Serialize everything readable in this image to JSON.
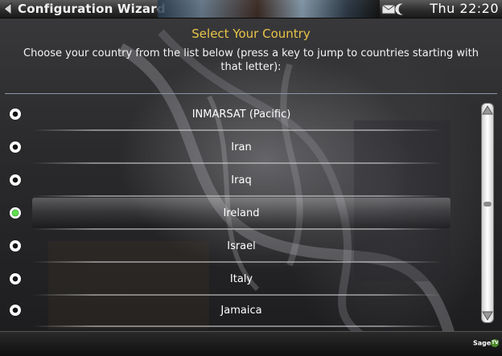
{
  "window": {
    "title": "Configuration Wizard",
    "clock": "Thu 22:20"
  },
  "header": {
    "heading": "Select Your Country",
    "instructions": "Choose your country from the list below (press a key to jump to countries starting with that letter):"
  },
  "countries": [
    {
      "label": "INMARSAT (Pacific)",
      "selected": false
    },
    {
      "label": "Iran",
      "selected": false
    },
    {
      "label": "Iraq",
      "selected": false
    },
    {
      "label": "Ireland",
      "selected": true
    },
    {
      "label": "Israel",
      "selected": false
    },
    {
      "label": "Italy",
      "selected": false
    },
    {
      "label": "Jamaica",
      "selected": false
    }
  ],
  "footer": {
    "logo": "Sage",
    "logo_badge": "TV"
  },
  "colors": {
    "heading": "#e8c449",
    "radio_selected": "#5fe04d",
    "separator": "#8a96a6"
  },
  "icons": [
    "back-arrow-icon",
    "mail-icon",
    "moon-icon",
    "radio-icon",
    "scroll-up-arrow-icon",
    "scroll-down-arrow-icon"
  ]
}
